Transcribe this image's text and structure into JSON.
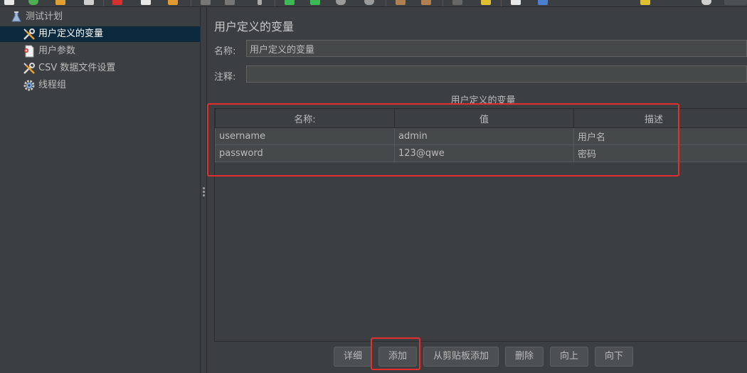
{
  "tree": {
    "items": [
      {
        "label": "测试计划",
        "icon": "flask-icon"
      },
      {
        "label": "用户定义的变量",
        "icon": "wrench-screwdriver-icon",
        "selected": true
      },
      {
        "label": "用户参数",
        "icon": "document-icon"
      },
      {
        "label": "CSV 数据文件设置",
        "icon": "wrench-screwdriver-icon"
      },
      {
        "label": "线程组",
        "icon": "gear-icon"
      }
    ]
  },
  "panel": {
    "title": "用户定义的变量",
    "name_label": "名称:",
    "name_value": "用户定义的变量",
    "comment_label": "注释:",
    "comment_value": ""
  },
  "table": {
    "caption": "用户定义的变量",
    "headers": [
      "名称:",
      "值",
      "描述"
    ],
    "rows": [
      [
        "username",
        "admin",
        "用户名"
      ],
      [
        "password",
        "123@qwe",
        "密码"
      ]
    ]
  },
  "buttons": {
    "detail": "详细",
    "add": "添加",
    "add_from_clipboard": "从剪贴板添加",
    "delete": "删除",
    "up": "向上",
    "down": "向下"
  },
  "colors": {
    "background": "#3c3f41",
    "selection": "#0d293e",
    "highlight": "#e52e2e"
  }
}
